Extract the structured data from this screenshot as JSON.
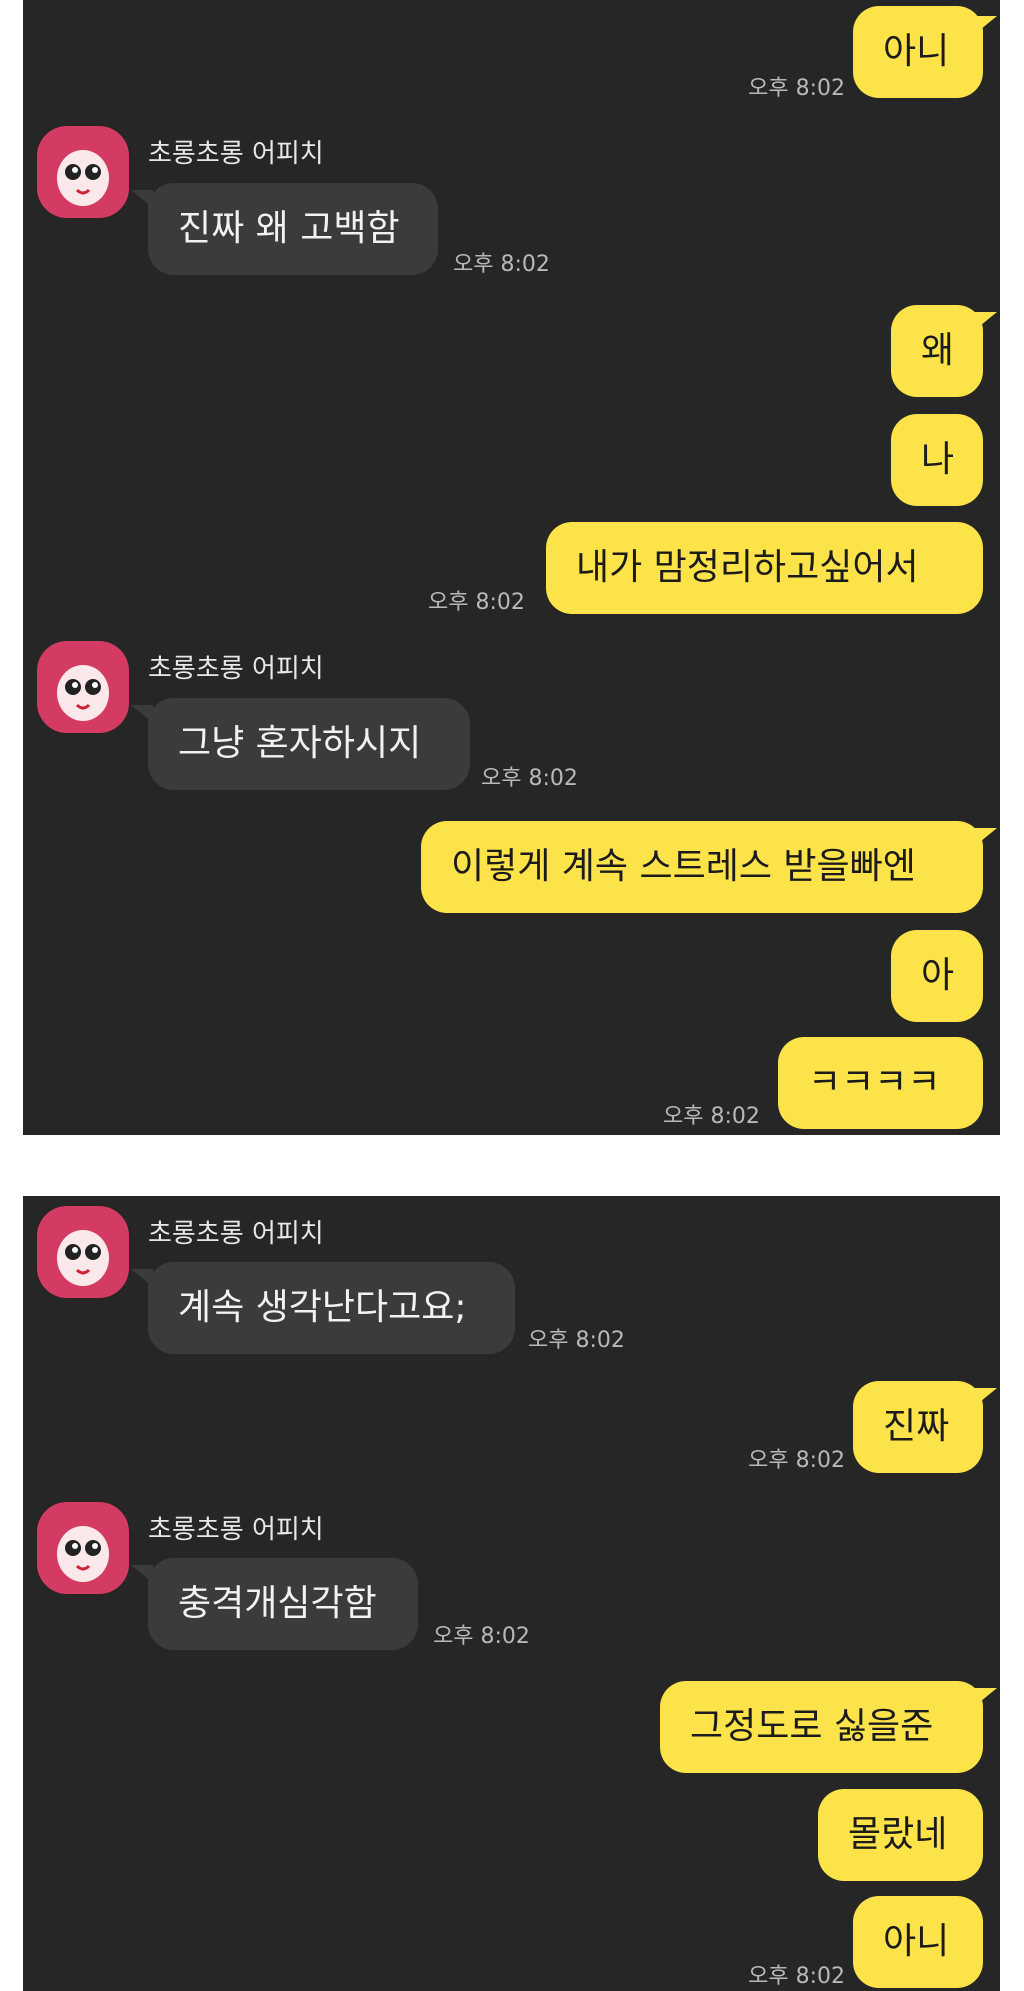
{
  "sender_name": "초롱초롱 어피치",
  "time": "오후 8:02",
  "panel1": {
    "messages": [
      {
        "from": "me",
        "text": "아니",
        "show_time": true
      },
      {
        "from": "them",
        "text": "진짜 왜 고백함",
        "show_time": true
      },
      {
        "from": "me",
        "text": "왜",
        "show_time": false
      },
      {
        "from": "me",
        "text": "나",
        "show_time": false
      },
      {
        "from": "me",
        "text": "내가 맘정리하고싶어서",
        "show_time": true
      },
      {
        "from": "them",
        "text": "그냥 혼자하시지",
        "show_time": true
      },
      {
        "from": "me",
        "text": "이렇게 계속 스트레스 받을빠엔",
        "show_time": false
      },
      {
        "from": "me",
        "text": "아",
        "show_time": false
      },
      {
        "from": "me",
        "text": "ㅋㅋㅋㅋ",
        "show_time": true
      }
    ]
  },
  "panel2": {
    "messages": [
      {
        "from": "them",
        "text": "계속 생각난다고요;",
        "show_time": true
      },
      {
        "from": "me",
        "text": "진짜",
        "show_time": true
      },
      {
        "from": "them",
        "text": "충격개심각함",
        "show_time": true
      },
      {
        "from": "me",
        "text": "그정도로 싫을준",
        "show_time": false
      },
      {
        "from": "me",
        "text": "몰랐네",
        "show_time": false
      },
      {
        "from": "me",
        "text": "아니",
        "show_time": true
      }
    ]
  },
  "colors": {
    "background": "#262626",
    "my_bubble": "#fde34a",
    "their_bubble": "#3b3b3b",
    "avatar": "#d43b63"
  },
  "icons": {
    "avatar": "apeach-avatar-icon"
  }
}
